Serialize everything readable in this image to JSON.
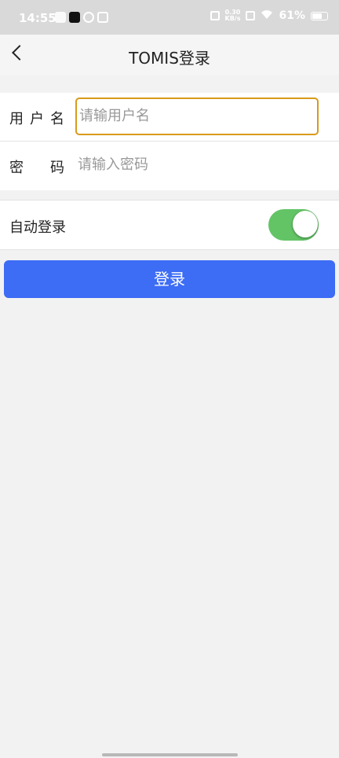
{
  "status_bar": {
    "time": "14:55",
    "net_speed_top": "0.30",
    "net_speed_bottom": "KB/s",
    "battery": "61%"
  },
  "header": {
    "title": "TOMIS登录"
  },
  "form": {
    "username_label_chars": [
      "用",
      "户",
      "名"
    ],
    "username_placeholder": "请输用户名",
    "password_label_chars": [
      "密",
      "码"
    ],
    "password_placeholder": "请输入密码"
  },
  "auto_login": {
    "label": "自动登录",
    "enabled": true
  },
  "login_button": {
    "label": "登录"
  },
  "colors": {
    "primary": "#3d6cf5",
    "toggle_on": "#63c466",
    "focus_border": "#d89a1a"
  }
}
